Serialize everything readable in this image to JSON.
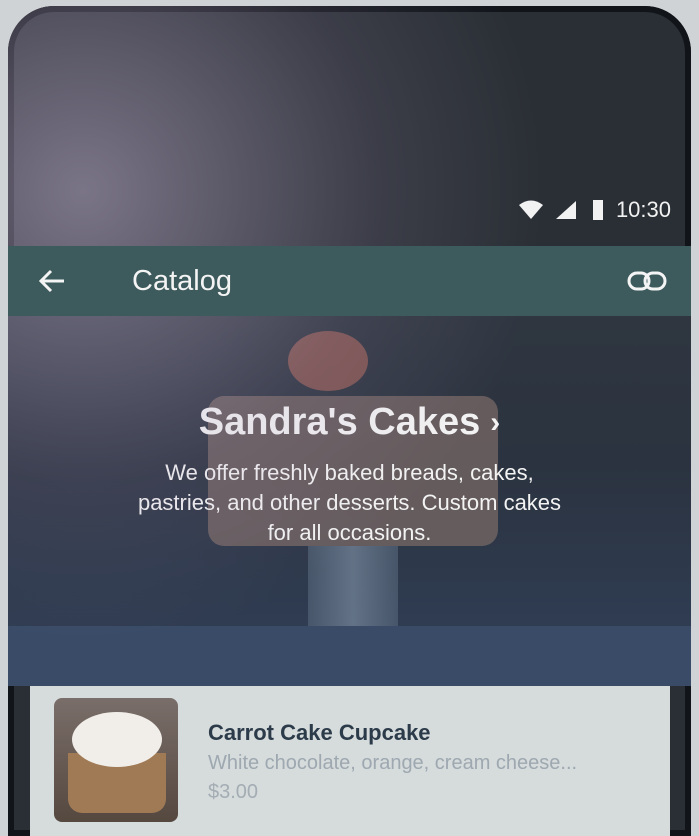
{
  "status": {
    "time": "10:30"
  },
  "appbar": {
    "title": "Catalog"
  },
  "shop": {
    "name": "Sandra's Cakes",
    "description": "We offer freshly baked breads, cakes, pastries, and other desserts. Custom cakes for all occasions."
  },
  "products": [
    {
      "name": "Carrot Cake Cupcake",
      "description": "White chocolate, orange, cream cheese...",
      "price": "$3.00"
    }
  ],
  "colors": {
    "appbar": "#3d5a5c",
    "text_primary": "#2c3b4a"
  }
}
